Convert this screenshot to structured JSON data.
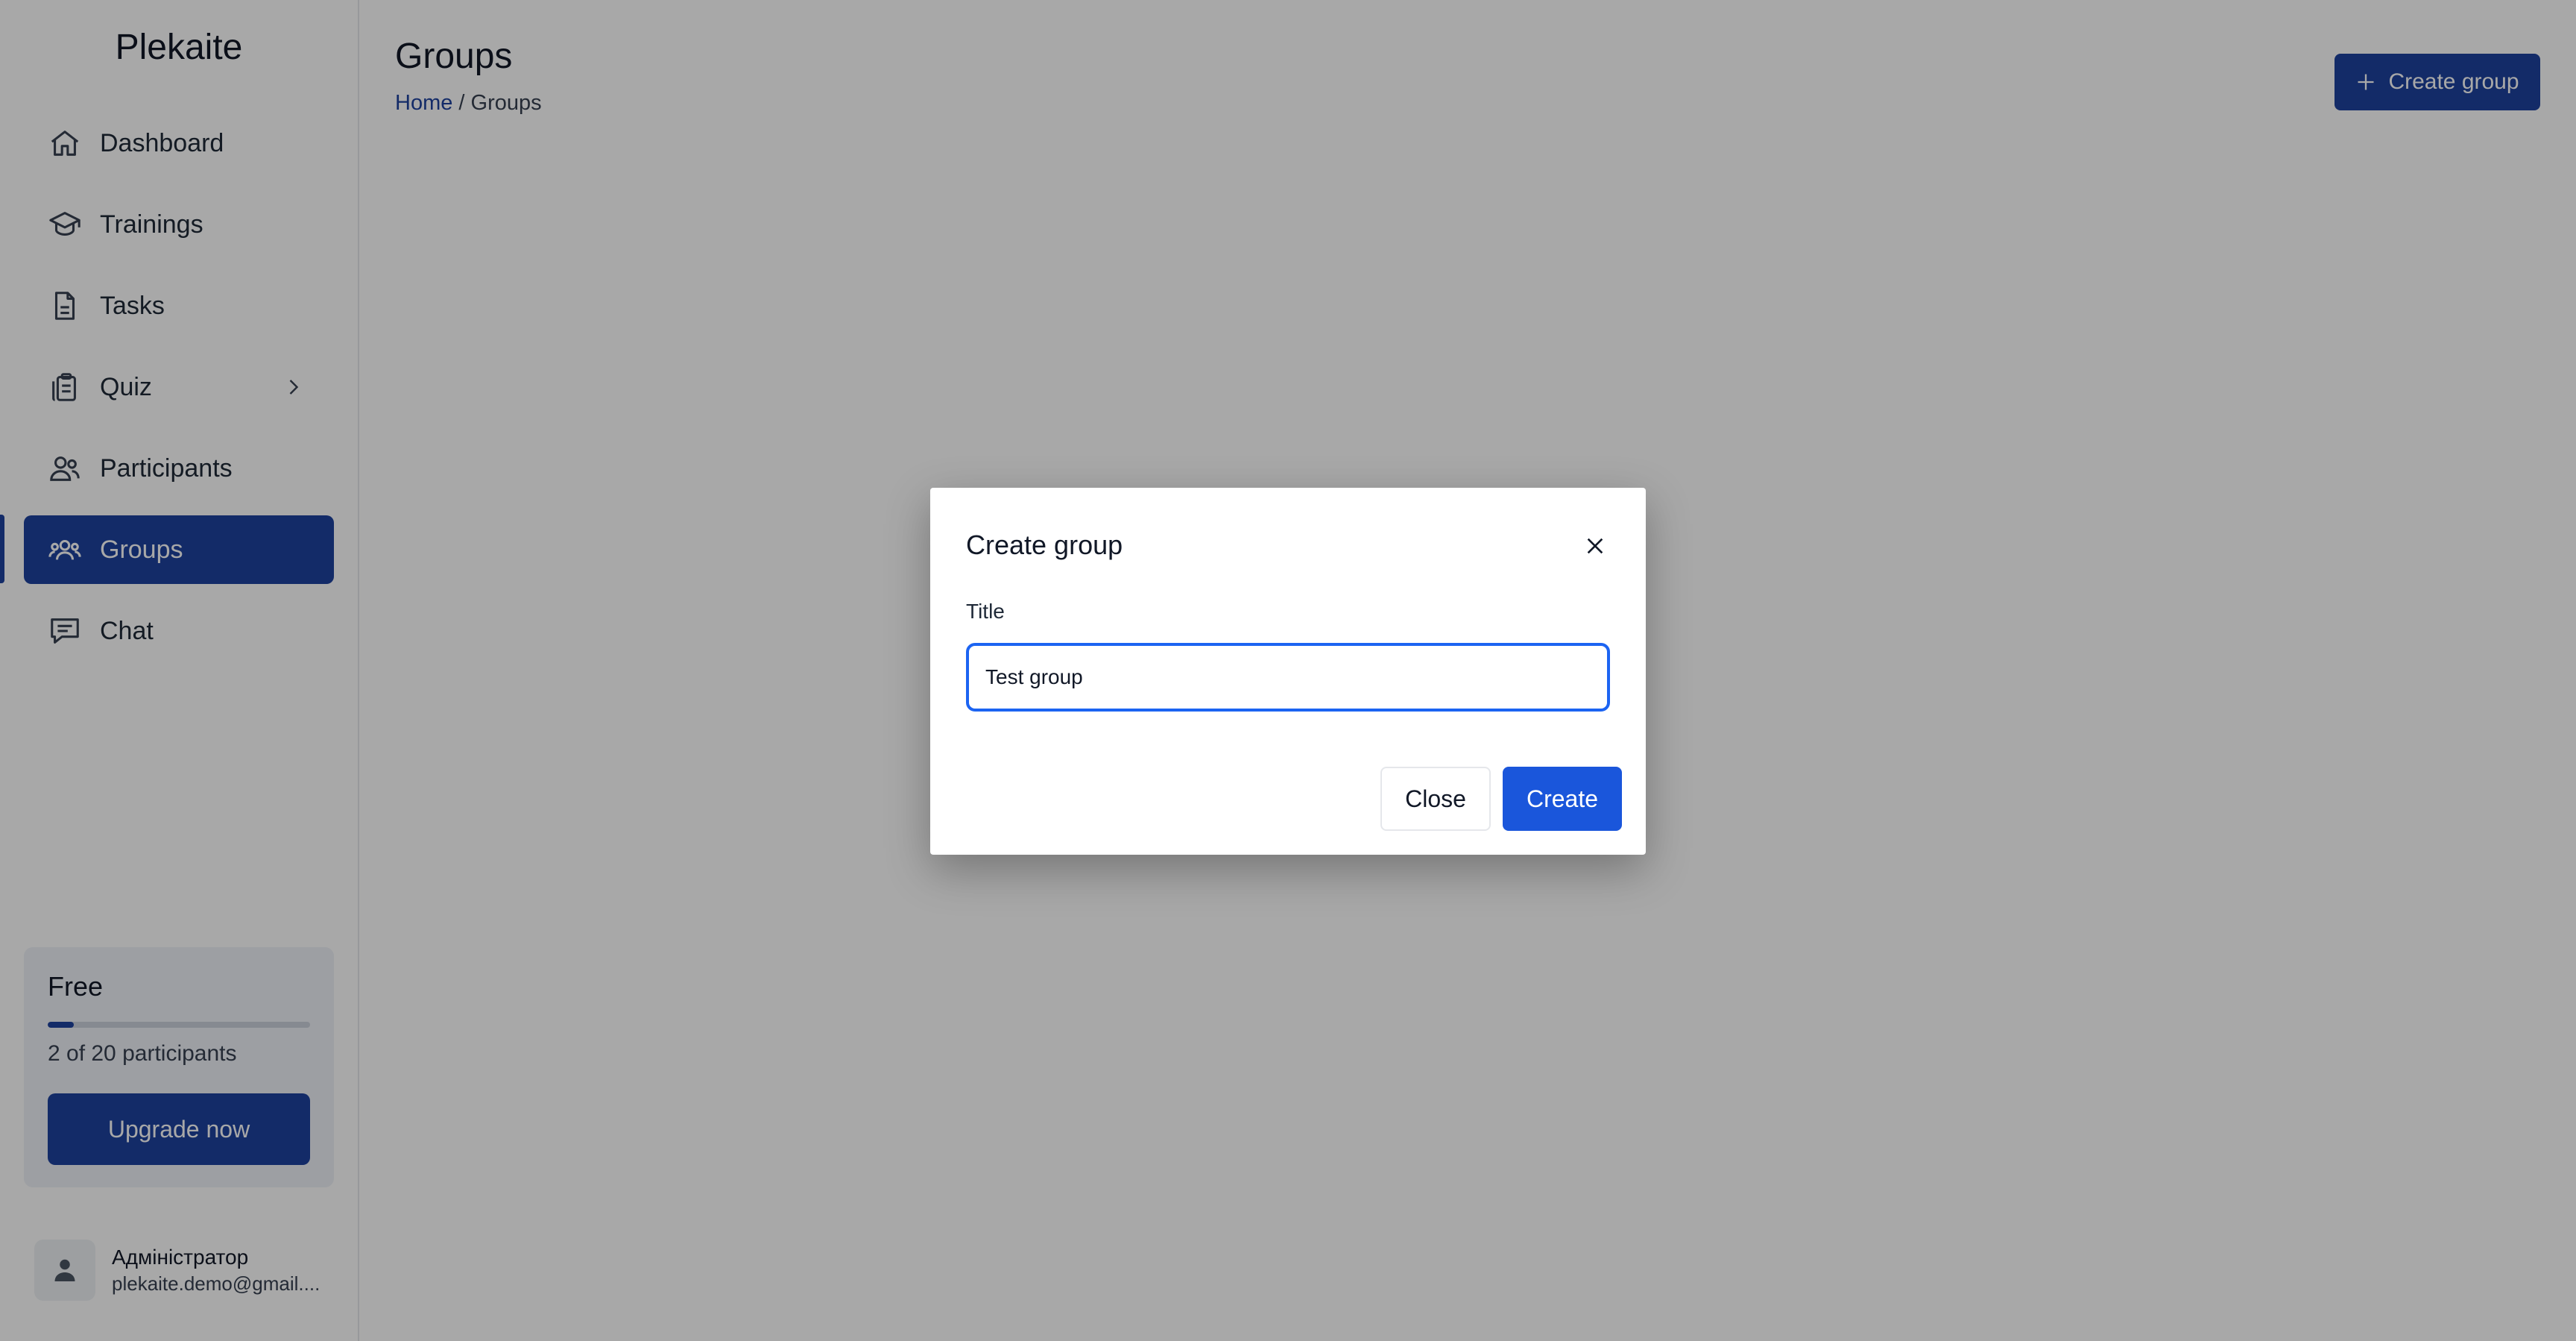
{
  "app": {
    "brand": "Plekaite"
  },
  "sidebar": {
    "items": [
      {
        "label": "Dashboard",
        "icon": "home-icon",
        "active": false
      },
      {
        "label": "Trainings",
        "icon": "graduation-cap-icon",
        "active": false
      },
      {
        "label": "Tasks",
        "icon": "document-icon",
        "active": false
      },
      {
        "label": "Quiz",
        "icon": "clipboard-icon",
        "active": false,
        "has_submenu": true
      },
      {
        "label": "Participants",
        "icon": "users-icon",
        "active": false
      },
      {
        "label": "Groups",
        "icon": "user-group-icon",
        "active": true
      },
      {
        "label": "Chat",
        "icon": "chat-icon",
        "active": false
      }
    ],
    "plan": {
      "name": "Free",
      "usage_text": "2 of 20 participants",
      "used": 2,
      "limit": 20,
      "upgrade_label": "Upgrade now"
    },
    "user": {
      "name": "Адміністратор",
      "email": "plekaite.demo@gmail...."
    }
  },
  "main": {
    "title": "Groups",
    "breadcrumb": {
      "home": "Home",
      "separator": " / ",
      "current": "Groups"
    },
    "create_button_label": "Create group"
  },
  "modal": {
    "title": "Create group",
    "field_label": "Title",
    "field_value": "Test group",
    "close_label": "Close",
    "create_label": "Create"
  },
  "colors": {
    "accent": "#1e429f",
    "primary_button": "#1a56db",
    "focus_border": "#1c64f2",
    "overlay": "rgba(0,0,0,0.34)"
  }
}
